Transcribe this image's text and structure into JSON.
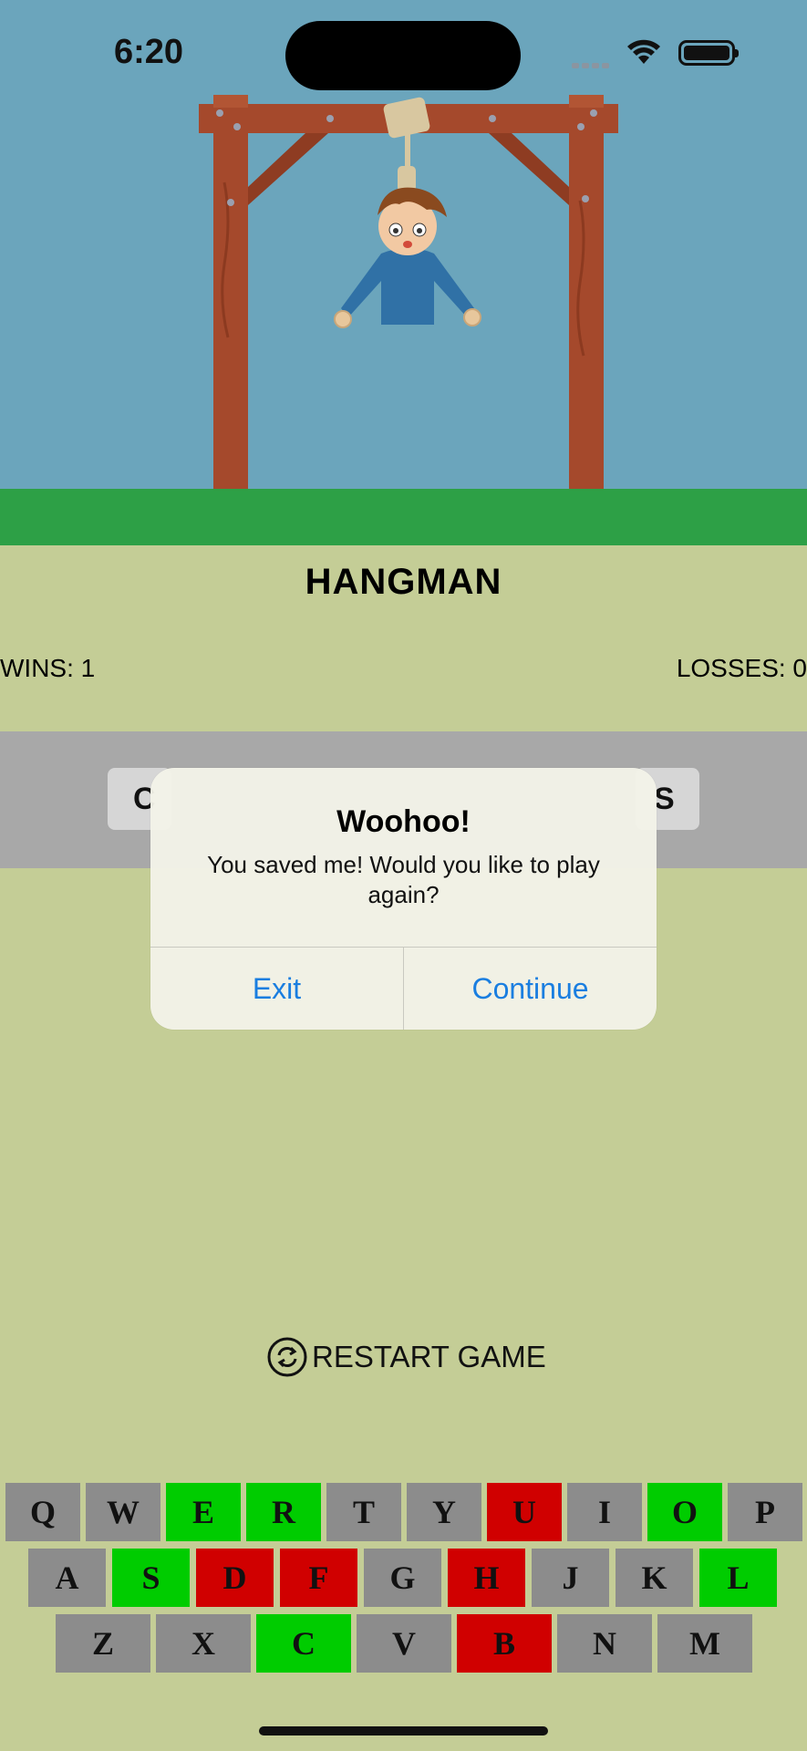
{
  "status_bar": {
    "time": "6:20"
  },
  "game": {
    "title": "HANGMAN",
    "wins_label": "WINS: 1",
    "losses_label": "LOSSES: 0",
    "word_left_fragment": "C",
    "word_right_fragment": "S"
  },
  "dialog": {
    "title": "Woohoo!",
    "message": "You saved me! Would you like to play again?",
    "exit_label": "Exit",
    "continue_label": "Continue"
  },
  "restart": {
    "label": "RESTART GAME",
    "icon": "restart-icon"
  },
  "colors": {
    "sky": "#6ba5bc",
    "grass": "#2da046",
    "background": "#c4cd96",
    "key_default": "#8c8c8c",
    "key_correct": "#00cc00",
    "key_wrong": "#d00000",
    "link_blue": "#1a7ee0"
  },
  "keyboard": {
    "rows": [
      [
        {
          "letter": "Q",
          "state": "unused"
        },
        {
          "letter": "W",
          "state": "unused"
        },
        {
          "letter": "E",
          "state": "correct"
        },
        {
          "letter": "R",
          "state": "correct"
        },
        {
          "letter": "T",
          "state": "unused"
        },
        {
          "letter": "Y",
          "state": "unused"
        },
        {
          "letter": "U",
          "state": "wrong"
        },
        {
          "letter": "I",
          "state": "unused"
        },
        {
          "letter": "O",
          "state": "correct"
        },
        {
          "letter": "P",
          "state": "unused"
        }
      ],
      [
        {
          "letter": "A",
          "state": "unused"
        },
        {
          "letter": "S",
          "state": "correct"
        },
        {
          "letter": "D",
          "state": "wrong"
        },
        {
          "letter": "F",
          "state": "wrong"
        },
        {
          "letter": "G",
          "state": "unused"
        },
        {
          "letter": "H",
          "state": "wrong"
        },
        {
          "letter": "J",
          "state": "unused"
        },
        {
          "letter": "K",
          "state": "unused"
        },
        {
          "letter": "L",
          "state": "correct"
        }
      ],
      [
        {
          "letter": "Z",
          "state": "unused"
        },
        {
          "letter": "X",
          "state": "unused"
        },
        {
          "letter": "C",
          "state": "correct"
        },
        {
          "letter": "V",
          "state": "unused"
        },
        {
          "letter": "B",
          "state": "wrong"
        },
        {
          "letter": "N",
          "state": "unused"
        },
        {
          "letter": "M",
          "state": "unused"
        }
      ]
    ]
  }
}
